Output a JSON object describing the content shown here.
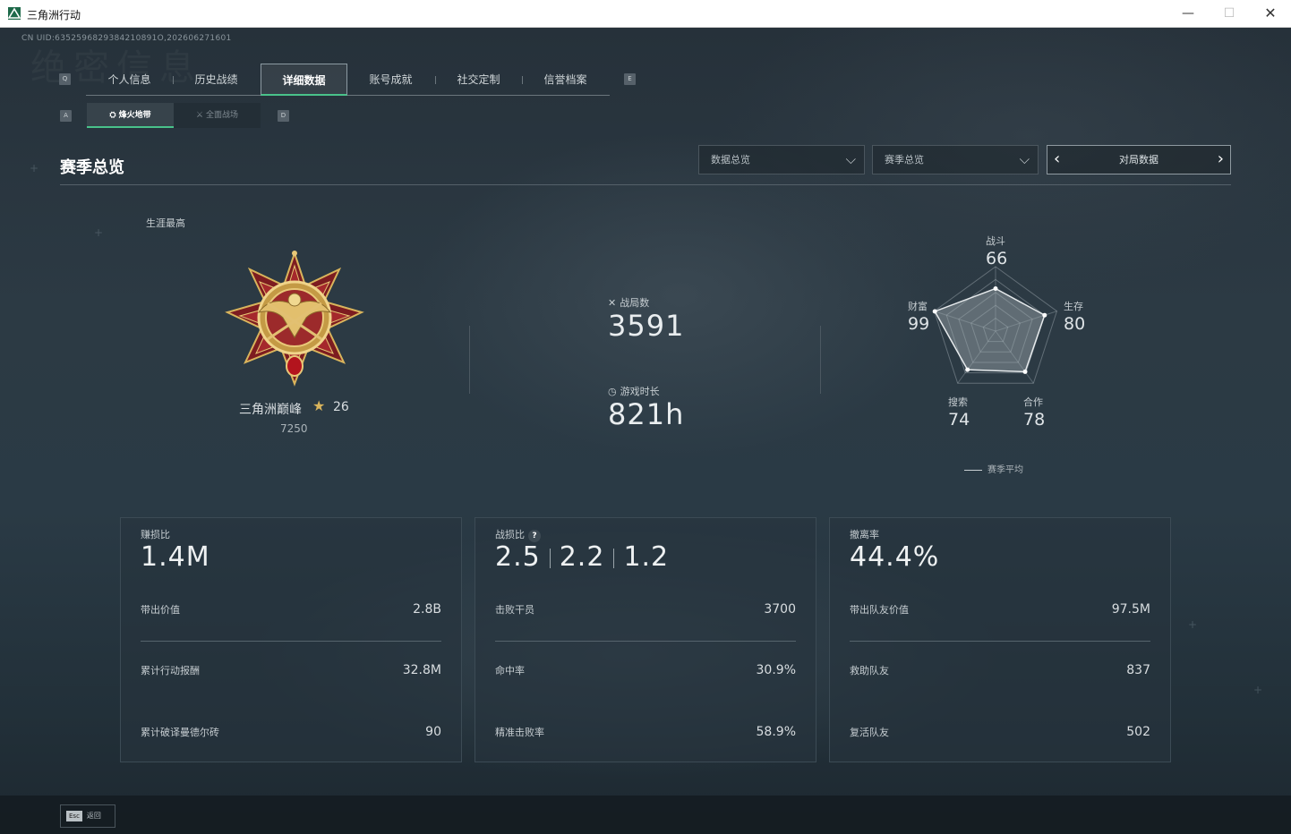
{
  "window": {
    "title": "三角洲行动",
    "minimize": "—",
    "maximize": "☐",
    "close": "✕"
  },
  "uid": "CN UID:6352596829384210891O,202606271601",
  "keys": {
    "prev_tab": "Q",
    "next_tab": "E",
    "prev_sub": "A",
    "next_sub": "D"
  },
  "tabs": [
    {
      "label": "个人信息"
    },
    {
      "label": "历史战绩"
    },
    {
      "label": "详细数据",
      "active": true
    },
    {
      "label": "账号成就"
    },
    {
      "label": "社交定制"
    },
    {
      "label": "信誉档案"
    }
  ],
  "subtabs": [
    {
      "label": "烽火地带",
      "icon": "extraction-icon",
      "active": true
    },
    {
      "label": "全面战场",
      "icon": "warfare-icon"
    }
  ],
  "section": {
    "title": "赛季总览"
  },
  "filters": {
    "data_dropdown": "数据总览",
    "season_dropdown": "赛季总览",
    "pager_label": "对局数据"
  },
  "rank": {
    "caption": "生涯最高",
    "name": "三角洲巅峰",
    "stars": "26",
    "score": "7250"
  },
  "stats": {
    "matches_label": "战局数",
    "matches_value": "3591",
    "playtime_label": "游戏时长",
    "playtime_value": "821h"
  },
  "radar": {
    "axes": [
      {
        "label": "战斗",
        "value": "66",
        "score": 66
      },
      {
        "label": "生存",
        "value": "80",
        "score": 80
      },
      {
        "label": "合作",
        "value": "78",
        "score": 78
      },
      {
        "label": "搜索",
        "value": "74",
        "score": 74
      },
      {
        "label": "财富",
        "value": "99",
        "score": 99
      }
    ],
    "legend": "赛季平均"
  },
  "cards": [
    {
      "title": "赚损比",
      "value": "1.4M",
      "rows": [
        {
          "label": "带出价值",
          "value": "2.8B"
        },
        {
          "label": "累计行动报酬",
          "value": "32.8M"
        },
        {
          "label": "累计破译曼德尔砖",
          "value": "90"
        }
      ]
    },
    {
      "title": "战损比",
      "help": "?",
      "values": [
        "2.5",
        "2.2",
        "1.2"
      ],
      "rows": [
        {
          "label": "击败干员",
          "value": "3700"
        },
        {
          "label": "命中率",
          "value": "30.9%"
        },
        {
          "label": "精准击败率",
          "value": "58.9%"
        }
      ]
    },
    {
      "title": "撤离率",
      "value": "44.4%",
      "rows": [
        {
          "label": "带出队友价值",
          "value": "97.5M"
        },
        {
          "label": "救助队友",
          "value": "837"
        },
        {
          "label": "复活队友",
          "value": "502"
        }
      ]
    }
  ],
  "footer": {
    "esc_key": "Esc",
    "back_label": "返回"
  },
  "colors": {
    "accent": "#49c28a",
    "medal_gold": "#d9b45c",
    "medal_red": "#8e1f24"
  }
}
